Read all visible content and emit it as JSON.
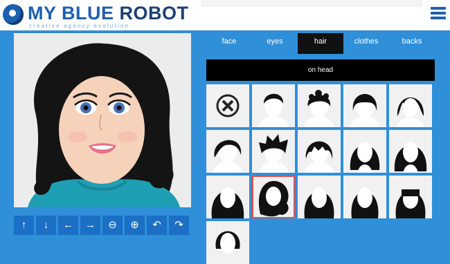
{
  "header": {
    "logo_title_blue": "MY BLUE",
    "logo_title_dark": " ROBOT",
    "logo_subtitle": "creative agency evolution",
    "menu_icon": "hamburger-menu-icon"
  },
  "tabs": [
    {
      "label": "face",
      "active": false
    },
    {
      "label": "eyes",
      "active": false
    },
    {
      "label": "hair",
      "active": true
    },
    {
      "label": "clothes",
      "active": false
    },
    {
      "label": "backs",
      "active": false
    }
  ],
  "subheader": {
    "label": "on head"
  },
  "controls": [
    {
      "icon": "arrow-up-icon",
      "glyph": "↑"
    },
    {
      "icon": "arrow-down-icon",
      "glyph": "↓"
    },
    {
      "icon": "arrow-left-icon",
      "glyph": "←"
    },
    {
      "icon": "arrow-right-icon",
      "glyph": "→"
    },
    {
      "icon": "zoom-out-icon",
      "glyph": "🔍"
    },
    {
      "icon": "zoom-in-icon",
      "glyph": "🔍"
    },
    {
      "icon": "rotate-left-icon",
      "glyph": "↶"
    },
    {
      "icon": "rotate-right-icon",
      "glyph": "↷"
    }
  ],
  "hair_options": [
    {
      "id": "none",
      "icon": "remove-icon"
    },
    {
      "id": "short-1",
      "icon": "hair-short-icon"
    },
    {
      "id": "curly-short",
      "icon": "hair-curly-icon"
    },
    {
      "id": "bowl",
      "icon": "hair-bowl-icon"
    },
    {
      "id": "bob",
      "icon": "hair-bob-icon"
    },
    {
      "id": "wavy-short",
      "icon": "hair-wavy-icon"
    },
    {
      "id": "spiky",
      "icon": "hair-spiky-icon"
    },
    {
      "id": "shaggy",
      "icon": "hair-shaggy-icon"
    },
    {
      "id": "long-1",
      "icon": "hair-long-icon"
    },
    {
      "id": "long-2",
      "icon": "hair-long-icon"
    },
    {
      "id": "long-wavy",
      "icon": "hair-long-wavy-icon"
    },
    {
      "id": "long-curly-selected",
      "icon": "hair-long-curly-icon",
      "selected": true
    },
    {
      "id": "long-3",
      "icon": "hair-long-icon"
    },
    {
      "id": "long-4",
      "icon": "hair-long-icon"
    },
    {
      "id": "long-bangs",
      "icon": "hair-bangs-icon"
    },
    {
      "id": "short-2",
      "icon": "hair-short-icon"
    }
  ],
  "accent": "#2f8fd8",
  "selected_border": "#d9534f"
}
